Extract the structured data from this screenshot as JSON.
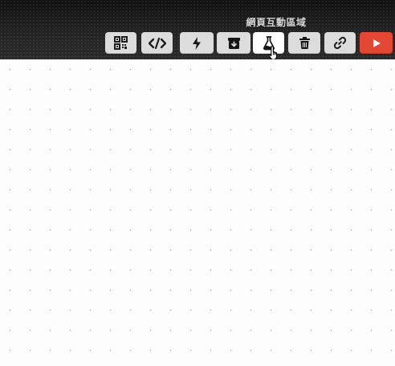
{
  "toolbar": {
    "tooltip": "網頁互動區域",
    "buttons": [
      {
        "name": "qrcode-button",
        "icon": "qrcode-icon"
      },
      {
        "name": "code-button",
        "icon": "code-icon"
      },
      {
        "name": "flash-button",
        "icon": "lightning-icon"
      },
      {
        "name": "save-button",
        "icon": "archive-download-icon"
      },
      {
        "name": "lab-button",
        "icon": "flask-icon",
        "active": true
      },
      {
        "name": "delete-button",
        "icon": "trash-icon"
      },
      {
        "name": "link-button",
        "icon": "link-icon"
      },
      {
        "name": "run-button",
        "icon": "play-icon"
      }
    ]
  },
  "colors": {
    "toolbar_bg": "#262626",
    "button_bg": "#dcdcdc",
    "active_button_bg": "#ffffff",
    "run_button_bg": "#e24733",
    "canvas_bg": "#fdfdfd",
    "grid_dot": "#a9b6c9"
  }
}
